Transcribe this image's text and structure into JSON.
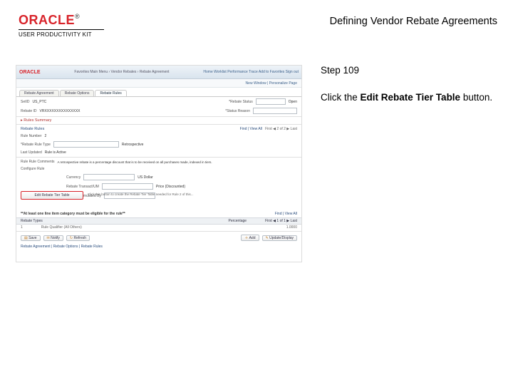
{
  "header": {
    "brand": "ORACLE",
    "tm": "®",
    "kit": "USER PRODUCTIVITY KIT",
    "doc_title": "Defining Vendor Rebate Agreements"
  },
  "side": {
    "step": "Step 109",
    "instruction_pre": "Click the ",
    "instruction_bold": "Edit Rebate Tier Table",
    "instruction_post": " button."
  },
  "shot": {
    "crumbs": "Favorites   Main Menu  › Vendor Rebates › Rebate Agreement",
    "rlinks": "Home   Worklist   Performance Trace   Add to Favorites   Sign out",
    "band1": "New Window | Personalize Page",
    "tabs": {
      "t1": "Rebate Agreement",
      "t2": "Rebate Options",
      "t3": "Rebate Rules"
    },
    "setid_lbl": "SetID",
    "setid_val": "US_PTC",
    "status_lbl": "*Rebate Status",
    "status_val": "Open",
    "rebateid_lbl": "Rebate ID",
    "rebateid_val": "VRXXXXXXXXXXXXXXX",
    "reason_lbl": "*Status Reason",
    "sect_summary": "▸ Rules Summary",
    "sect_rules": "Rebate Rules",
    "ruleno_lbl": "Rule Number",
    "ruleno_val": "2",
    "ruletype_lbl": "*Rebate Rule Type",
    "ruletype_val": "Retrospective",
    "find1": "Find | View All",
    "nav1": "First ◀ 2 of 2 ▶ Last",
    "lastupd_lbl": "Last Updated",
    "lastupd_val": "Rule is Active",
    "rulecmt_lbl": "Rule Rule Comments",
    "rulecmt_val": "A retrospective rebate is a percentage discount that is to be received on all purchases made, indexed in tiers.",
    "cfg_lbl": "Configure Rule",
    "curr_lbl": "Currency",
    "curr_val": "US Dollar",
    "trx_lbl": "Rebate Transact/UM",
    "trx_val": "Price (Discounted)",
    "cum_lbl": "Rebate Cumulated By",
    "edit_btn": "Edit Rebate Tier Table",
    "edit_note": "Click this button to create the Rebate Tier Table needed for Rule 2 of this...",
    "rulecat_hdr": "**At least one line item category must be eligible for the rule**",
    "find2": "Find | View All",
    "tbl_cat": "Rebate Types",
    "tbl_desc": "Rule Qualifier (All Others)",
    "tbl_perc": "Percentage",
    "tbl_nav": "First ◀ 1 of 1 ▶ Last",
    "tbl_row1_idx": "1",
    "tbl_row1_val": "1.0000",
    "save": "Save",
    "notify": "Notify",
    "refresh": "Refresh",
    "add": "Add",
    "upd": "Update/Display",
    "footer_tabs": "Rebate Agreement | Rebate Options | Rebate Rules"
  }
}
